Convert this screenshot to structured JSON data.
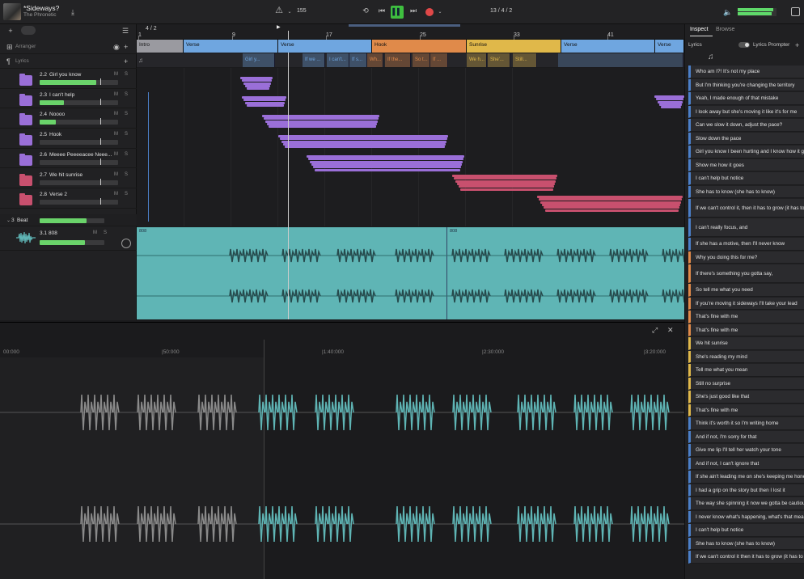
{
  "header": {
    "song_title": "*Sideways?",
    "artist": "The Phronetic",
    "tempo": "155",
    "position": "13 / 4 / 2",
    "time_signature": "4 / 2"
  },
  "left": {
    "arranger_label": "Arranger",
    "lyrics_label": "Lyrics",
    "tracks": [
      {
        "num": "2.2",
        "name": "Girl you know",
        "color": "#9a6fd8"
      },
      {
        "num": "2.3",
        "name": "I can't help",
        "color": "#9a6fd8"
      },
      {
        "num": "2.4",
        "name": "Noooo",
        "color": "#9a6fd8"
      },
      {
        "num": "2.5",
        "name": "Hook",
        "color": "#9a6fd8"
      },
      {
        "num": "2.6",
        "name": "Meeee Peeeeacee Neee...",
        "color": "#9a6fd8"
      },
      {
        "num": "2.7",
        "name": "We hit sunrise",
        "color": "#c8506e"
      },
      {
        "num": "2.8",
        "name": "Verse 2",
        "color": "#c8506e"
      }
    ],
    "beat_group": {
      "num": "3",
      "name": "Beat"
    },
    "bass": {
      "num": "3.1",
      "name": "808"
    },
    "m": "M",
    "s": "S"
  },
  "ruler": {
    "bars": [
      "1",
      "9",
      "17",
      "25",
      "33",
      "41"
    ]
  },
  "sections": [
    {
      "label": "Intro",
      "color": "#9a9aa0"
    },
    {
      "label": "Verse",
      "color": "#6fa6e0"
    },
    {
      "label": "Verse",
      "color": "#6fa6e0"
    },
    {
      "label": "Hook",
      "color": "#e08a4a"
    },
    {
      "label": "Sunrise",
      "color": "#e0b84a"
    },
    {
      "label": "Verse",
      "color": "#6fa6e0"
    },
    {
      "label": "Verse",
      "color": "#6fa6e0"
    }
  ],
  "lyric_snips": [
    "Girl y...",
    "If we ...",
    "I can't...",
    "If s...",
    "Wh...",
    "If the...",
    "So t...",
    "If ...",
    "We h...",
    "She'...",
    "Still..."
  ],
  "clip_label": "808",
  "editor": {
    "times": [
      "00:000",
      "|50:000",
      "|1:40:000",
      "|2:30:000",
      "|3:20:000"
    ]
  },
  "right": {
    "tab_inspect": "Inspect",
    "tab_browse": "Browse",
    "lyrics_label": "Lyrics",
    "prompter_label": "Lyrics Prompter",
    "lines": [
      {
        "t": "Who am I?! It's not my place",
        "c": "#4b7fc8"
      },
      {
        "t": "But I'm thinking you're changing the territory",
        "c": "#4b7fc8"
      },
      {
        "t": "Yeah, I made enough of that mistake",
        "c": "#4b7fc8"
      },
      {
        "t": "I look away but she's moving it like it's for me",
        "c": "#4b7fc8"
      },
      {
        "t": "Can we slow it down, adjust the pace?",
        "c": "#4b7fc8"
      },
      {
        "t": "Slow down the pace",
        "c": "#4b7fc8"
      },
      {
        "t": "Girl you know I been hurting and I know how it goes",
        "c": "#4b7fc8"
      },
      {
        "t": "Show me how it goes",
        "c": "#4b7fc8"
      },
      {
        "t": "I can't help but notice",
        "c": "#4b7fc8"
      },
      {
        "t": "She has to know (she has to know)",
        "c": "#4b7fc8"
      },
      {
        "t": "If we can't control it, then it has to grow (it has to grow)",
        "c": "#4b7fc8"
      },
      {
        "t": "I can't really focus, and",
        "c": "#4b7fc8"
      },
      {
        "t": "If she has a motive, then I'll never know",
        "c": "#4b7fc8"
      },
      {
        "t": "Why you doing this for me?",
        "c": "#e08a4a"
      },
      {
        "t": "If there's something you gotta say,",
        "c": "#e08a4a"
      },
      {
        "t": "So tell me what you need",
        "c": "#e08a4a"
      },
      {
        "t": "If you're moving it sideways I'll take your lead",
        "c": "#e08a4a"
      },
      {
        "t": "That's fine with me",
        "c": "#e08a4a"
      },
      {
        "t": "That's fine with me",
        "c": "#e08a4a"
      },
      {
        "t": "We hit sunrise",
        "c": "#e0b84a"
      },
      {
        "t": "She's reading my mind",
        "c": "#e0b84a"
      },
      {
        "t": "Tell me what you mean",
        "c": "#e0b84a"
      },
      {
        "t": "Still no surprise",
        "c": "#e0b84a"
      },
      {
        "t": "She's just good like that",
        "c": "#e0b84a"
      },
      {
        "t": "That's fine with me",
        "c": "#e0b84a"
      },
      {
        "t": "Think it's worth it so I'm writing home",
        "c": "#4b7fc8"
      },
      {
        "t": "And if not, I'm sorry for that",
        "c": "#4b7fc8"
      },
      {
        "t": "Give me lip I'll tell her watch your tone",
        "c": "#4b7fc8"
      },
      {
        "t": "And if not, I can't ignore that",
        "c": "#4b7fc8"
      },
      {
        "t": "If she ain't leading me on she's keeping me honest",
        "c": "#4b7fc8"
      },
      {
        "t": "I had a grip on the story but then I lost it",
        "c": "#4b7fc8"
      },
      {
        "t": "The way she spinning it now we gotta be cautious",
        "c": "#4b7fc8"
      },
      {
        "t": "I never know what's happening, what's that mean",
        "c": "#4b7fc8"
      },
      {
        "t": "I can't help but notice",
        "c": "#4b7fc8"
      },
      {
        "t": "She has to know (she has to know)",
        "c": "#4b7fc8"
      },
      {
        "t": "If we can't control it then it has to grow (it has to grow)",
        "c": "#4b7fc8"
      }
    ]
  }
}
